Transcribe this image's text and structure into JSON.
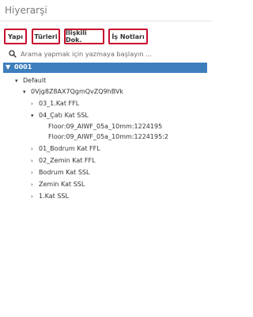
{
  "header": {
    "title": "Hiyerarşi"
  },
  "tabs": [
    {
      "label": "Yapı"
    },
    {
      "label": "Türleri"
    },
    {
      "label": "İlişkili Dok."
    },
    {
      "label": "İş Notları"
    }
  ],
  "search": {
    "placeholder": "Arama yapmak için yazmaya başlayın ..."
  },
  "tree": {
    "root": "0001",
    "default": "Default",
    "group": "0Vjg8Z8AX7QgmQvZQ9hBVk",
    "items": [
      {
        "label": "03_1.Kat FFL"
      },
      {
        "label": "04_Çatı Kat SSL"
      },
      {
        "label": "01_Bodrum Kat FFL"
      },
      {
        "label": "02_Zemin Kat FFL"
      },
      {
        "label": "Bodrum Kat SSL"
      },
      {
        "label": "Zemin Kat SSL"
      },
      {
        "label": "1.Kat SSL"
      }
    ],
    "floor_children": [
      "Floor:09_AIWF_05a_10mm:1224195",
      "Floor:09_AIWF_05a_10mm:1224195:2"
    ]
  },
  "colors": {
    "tab_border": "#c8102e",
    "root_highlight": "#3d7ebd"
  }
}
